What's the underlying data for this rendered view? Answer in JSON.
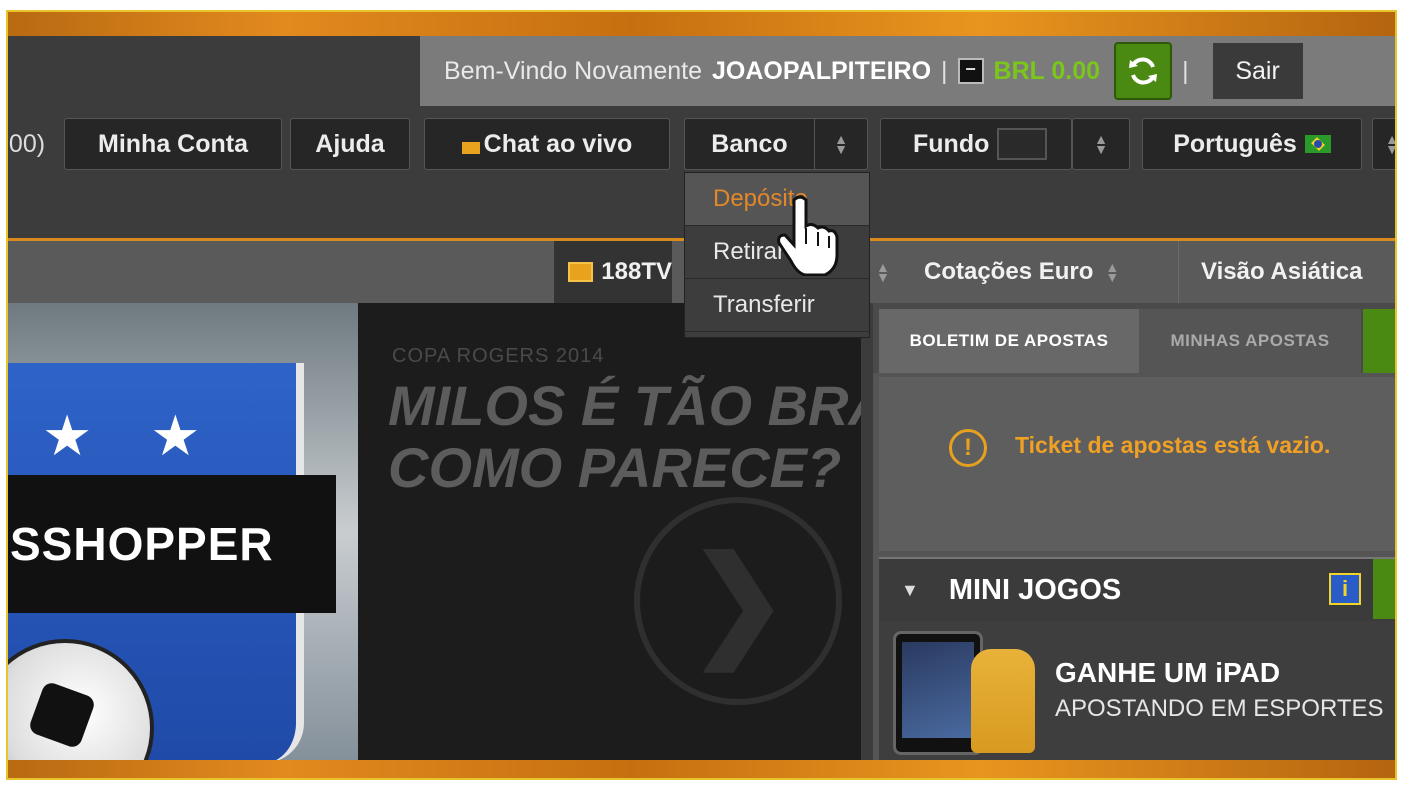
{
  "header": {
    "greeting": "Bem-Vindo Novamente",
    "username": "JOAOPALPITEIRO",
    "separator": "|",
    "minus_glyph": "−",
    "balance": "BRL 0.00",
    "logout_label": "Sair"
  },
  "nav": {
    "partial_left": "00)",
    "my_account": "Minha Conta",
    "help": "Ajuda",
    "live_chat": "Chat ao vivo",
    "bank": "Banco",
    "background": "Fundo",
    "language": "Português"
  },
  "bank_menu": {
    "items": [
      "Depósito",
      "Retirar",
      "Transferir"
    ],
    "active_index": 0
  },
  "subnav": {
    "tv": "188TV",
    "odds": "Cotações Euro",
    "view": "Visão Asiática"
  },
  "banner_left": {
    "text": "SSHOPPER"
  },
  "banner_mid": {
    "kicker": "COPA ROGERS 2014",
    "headline_line1": "MILOS É TÃO BRA",
    "headline_line2": "COMO PARECE?",
    "arrow_glyph": "❯"
  },
  "betslip": {
    "tab_active": "BOLETIM DE APOSTAS",
    "tab_inactive": "MINHAS APOSTAS",
    "warning_glyph": "!",
    "empty_message": "Ticket de apostas está vazio."
  },
  "mini_games": {
    "title": "MINI JOGOS",
    "info_glyph": "i",
    "promo_title": "GANHE UM iPAD",
    "promo_subtitle": "APOSTANDO EM ESPORTES"
  },
  "colors": {
    "accent_orange": "#d98a1d",
    "balance_green": "#7bc61a",
    "refresh_green": "#4a8a12",
    "warning_orange": "#f0a024"
  },
  "icons": [
    "refresh-icon",
    "chat-icon",
    "spinner-icon",
    "flag-brazil-icon",
    "tv-icon",
    "warning-icon",
    "info-icon",
    "hand-cursor-icon"
  ]
}
